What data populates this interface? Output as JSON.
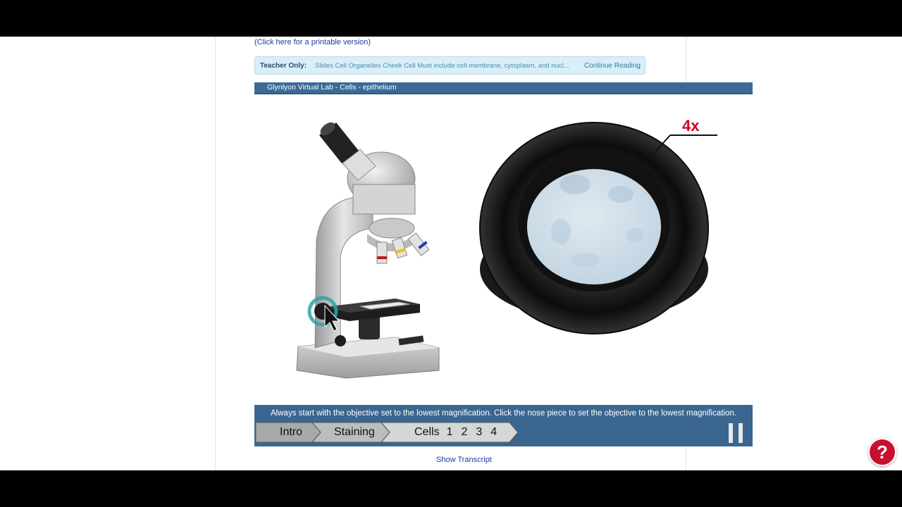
{
  "links": {
    "printable": "(Click here for a printable version)",
    "show_transcript": "Show Transcript"
  },
  "teacher_box": {
    "label": "Teacher Only:",
    "text": "Slides Cell Organelles Cheek Cell Must include cell membrane, cytoplasm, and nucl...",
    "continue": "Continue Reading"
  },
  "lab": {
    "title": "Glynlyon Virtual Lab - Cells - epithelium",
    "magnification_label": "4x",
    "instruction": "Always start with the objective set to the lowest magnification. Click the nose piece to set the objective to the lowest magnification.",
    "nav": {
      "intro": "Intro",
      "staining": "Staining",
      "cells": "Cells",
      "cell_numbers": [
        "1",
        "2",
        "3",
        "4"
      ]
    }
  },
  "help": {
    "label": "?"
  },
  "colors": {
    "header_blue": "#3b6b94",
    "instruction_bar": "#3a6690",
    "magnification_red": "#d0021b",
    "help_red": "#c8102e"
  }
}
